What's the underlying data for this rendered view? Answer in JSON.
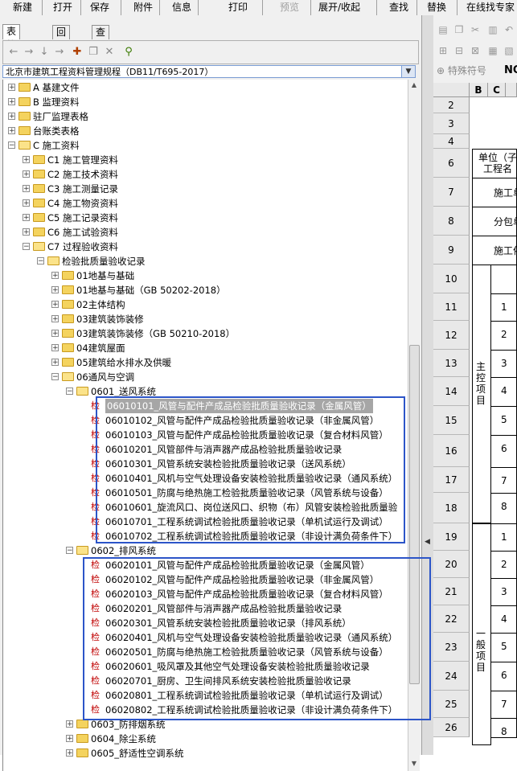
{
  "toolbar": {
    "items": [
      "新建",
      "打开",
      "保存",
      "附件",
      "信息",
      "打印",
      "预览",
      "展开/收起",
      "查找",
      "替换",
      "在线找专家"
    ]
  },
  "tabs": [
    "表格目录",
    "回收站",
    "查找结果"
  ],
  "spec": "北京市建筑工程资料管理规程（DB11/T695-2017）",
  "tree": {
    "top": [
      {
        "label": "A 基建文件"
      },
      {
        "label": "B 监理资料"
      },
      {
        "label": "驻厂监理表格"
      },
      {
        "label": "台账类表格"
      },
      {
        "label": "C 施工资料"
      }
    ],
    "c_children": [
      {
        "label": "C1 施工管理资料"
      },
      {
        "label": "C2 施工技术资料"
      },
      {
        "label": "C3 施工测量记录"
      },
      {
        "label": "C4 施工物资资料"
      },
      {
        "label": "C5 施工记录资料"
      },
      {
        "label": "C6 施工试验资料"
      },
      {
        "label": "C7 过程验收资料"
      }
    ],
    "c7_child": "检验批质量验收记录",
    "batches": [
      "01地基与基础",
      "01地基与基础（GB 50202-2018）",
      "02主体结构",
      "03建筑装饰装修",
      "03建筑装饰装修（GB 50210-2018）",
      "04建筑屋面",
      "05建筑给水排水及供暖",
      "06通风与空调"
    ],
    "badge": "检",
    "group1": {
      "label": "0601_送风系统",
      "items": [
        "06010101_风管与配件产成品检验批质量验收记录（金属风管）",
        "06010102_风管与配件产成品检验批质量验收记录（非金属风管）",
        "06010103_风管与配件产成品检验批质量验收记录（复合材料风管）",
        "06010201_风管部件与消声器产成品检验批质量验收记录",
        "06010301_风管系统安装检验批质量验收记录（送风系统）",
        "06010401_风机与空气处理设备安装检验批质量验收记录（通风系统）",
        "06010501_防腐与绝热施工检验批质量验收记录（风管系统与设备）",
        "06010601_旋流风口、岗位送风口、织物（布）风管安装检验批质量验",
        "06010701_工程系统调试检验批质量验收记录（单机试运行及调试）",
        "06010702_工程系统调试检验批质量验收记录（非设计满负荷条件下）"
      ]
    },
    "group2": {
      "label": "0602_排风系统",
      "items": [
        "06020101_风管与配件产成品检验批质量验收记录（金属风管）",
        "06020102_风管与配件产成品检验批质量验收记录（非金属风管）",
        "06020103_风管与配件产成品检验批质量验收记录（复合材料风管）",
        "06020201_风管部件与消声器产成品检验批质量验收记录",
        "06020301_风管系统安装检验批质量验收记录（排风系统）",
        "06020401_风机与空气处理设备安装检验批质量验收记录（通风系统）",
        "06020501_防腐与绝热施工检验批质量验收记录（风管系统与设备）",
        "06020601_吸风罩及其他空气处理设备安装检验批质量验收记录",
        "06020701_厨房、卫生间排风系统安装检验批质量验收记录",
        "06020801_工程系统调试检验批质量验收记录（单机试运行及调试）",
        "06020802_工程系统调试检验批质量验收记录（非设计满负荷条件下）"
      ]
    },
    "after": [
      "0603_防排烟系统",
      "0604_除尘系统",
      "0605_舒适性空调系统"
    ]
  },
  "right": {
    "special_char": "特殊符号",
    "no_label": "NO",
    "col_headers": [
      "B",
      "C"
    ],
    "rows": [
      "2",
      "3",
      "4",
      "6",
      "7",
      "8",
      "9",
      "10",
      "11",
      "12",
      "13",
      "14",
      "15",
      "16",
      "17",
      "18",
      "19",
      "20",
      "21",
      "22",
      "23",
      "24",
      "25",
      "26"
    ],
    "cell_texts": [
      "单位（子",
      "工程名",
      "施工单",
      "分包单",
      "施工依"
    ],
    "main_section": "主控项目",
    "general_section": "一般项目",
    "main_nums": [
      "1",
      "2",
      "3",
      "4",
      "5",
      "6",
      "7",
      "8"
    ],
    "general_nums": [
      "1",
      "2",
      "3",
      "4",
      "5",
      "6",
      "7",
      "8"
    ]
  }
}
